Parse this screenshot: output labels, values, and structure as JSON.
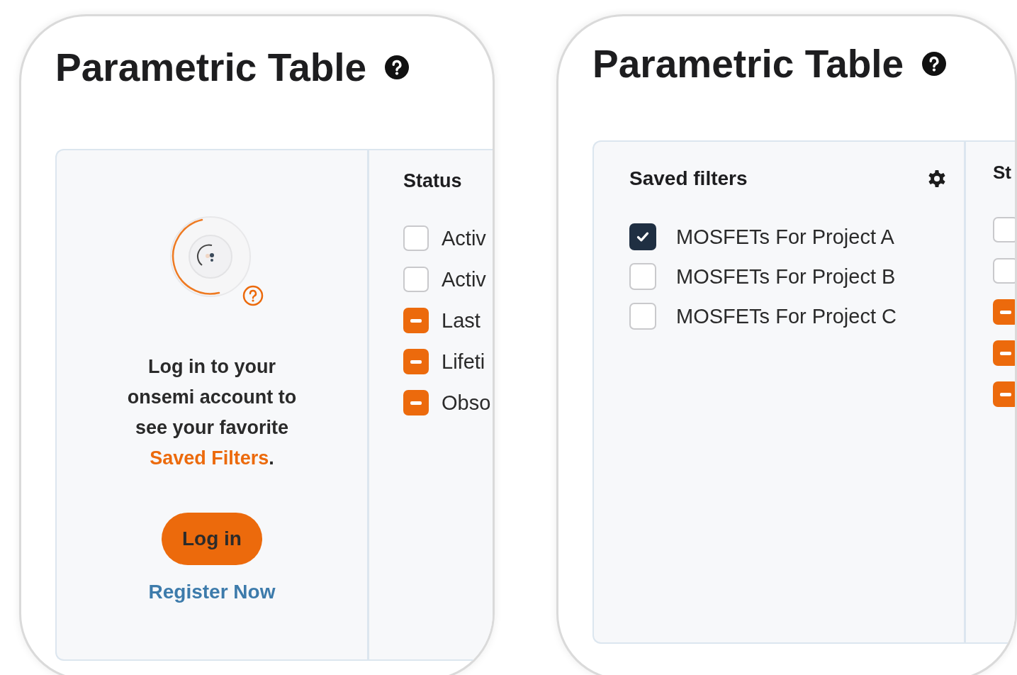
{
  "panels": [
    {
      "kind": "logged_out",
      "title": "Parametric Table",
      "login": {
        "message": "Log in to your onsemi account to see your favorite **Saved Filters**.",
        "button": "Log in",
        "link": "Register Now"
      },
      "status": {
        "heading": "Status",
        "options": [
          {
            "label": "Activ",
            "checked": false,
            "indeterminate": false
          },
          {
            "label": "Activ",
            "checked": false,
            "indeterminate": false
          },
          {
            "label": "Last",
            "checked": false,
            "indeterminate": true
          },
          {
            "label": "Lifeti",
            "checked": false,
            "indeterminate": true
          },
          {
            "label": "Obso",
            "checked": false,
            "indeterminate": true
          }
        ]
      }
    },
    {
      "kind": "saved_filters",
      "title": "Parametric Table",
      "filters": {
        "heading": "Saved filters",
        "items": [
          {
            "label": "MOSFETs For Project A",
            "checked": true
          },
          {
            "label": "MOSFETs For Project B",
            "checked": false
          },
          {
            "label": "MOSFETs For Project C",
            "checked": false
          }
        ]
      },
      "status": {
        "heading": "St",
        "options": [
          {
            "checked": false,
            "indeterminate": false
          },
          {
            "checked": false,
            "indeterminate": false
          },
          {
            "checked": false,
            "indeterminate": true
          },
          {
            "checked": false,
            "indeterminate": true
          },
          {
            "checked": false,
            "indeterminate": true
          }
        ]
      }
    }
  ]
}
